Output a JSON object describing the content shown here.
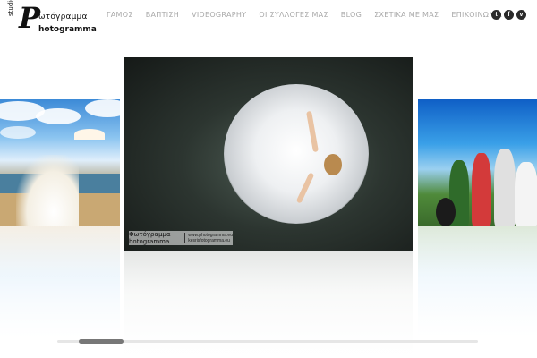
{
  "logo": {
    "studio": "studio",
    "line1": "ωτόγραμμα",
    "line2": "hotogramma",
    "mark": "P"
  },
  "nav": [
    "ΓΑΜΟΣ",
    "ΒΑΠΤΙΣΗ",
    "VIDEOGRAPHY",
    "ΟΙ ΣΥΛΛΟΓΕΣ ΜΑΣ",
    "BLOG",
    "ΣΧΕΤΙΚΑ ΜΕ ΜΑΣ",
    "ΕΠΙΚΟΙΝΩΝΙΑ"
  ],
  "social": [
    {
      "icon": "twitter-icon",
      "glyph": "t"
    },
    {
      "icon": "facebook-icon",
      "glyph": "f"
    },
    {
      "icon": "vimeo-icon",
      "glyph": "v"
    }
  ],
  "watermark": {
    "brand": "Φωτόγραμμα hotogramma",
    "url1": "www.photogramma.eu",
    "url2": "kesrisfotogramma.eu"
  },
  "colors": {
    "nav_text": "#a8a8a8",
    "social_bg": "#2a2a2a"
  },
  "slider": {
    "current_slide": 2
  }
}
